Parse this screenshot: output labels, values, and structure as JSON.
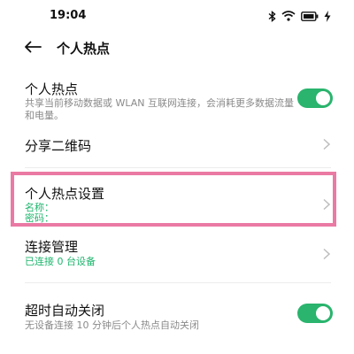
{
  "status_bar": {
    "time": "19:04",
    "icons": [
      "bluetooth-icon",
      "wifi-icon",
      "battery-icon",
      "charging-icon"
    ]
  },
  "header": {
    "back_icon": "arrow-left-icon",
    "title": "个人热点"
  },
  "items": {
    "hotspot_toggle": {
      "title": "个人热点",
      "description": "共享当前移动数据或 WLAN 互联网连接，会消耗更多数据流量和电量。",
      "enabled": true
    },
    "share_qr": {
      "title": "分享二维码"
    },
    "hotspot_settings": {
      "title": "个人热点设置",
      "name_label": "名称：",
      "password_label": "密码："
    },
    "connection_management": {
      "title": "连接管理",
      "status": "已连接 0 台设备"
    },
    "auto_off": {
      "title": "超时自动关闭",
      "description": "无设备连接 10 分钟后个人热点自动关闭",
      "enabled": true
    }
  },
  "colors": {
    "accent": "#2ab46d",
    "highlight": "#ea7aa3",
    "secondary_text": "#8a8a8a"
  }
}
